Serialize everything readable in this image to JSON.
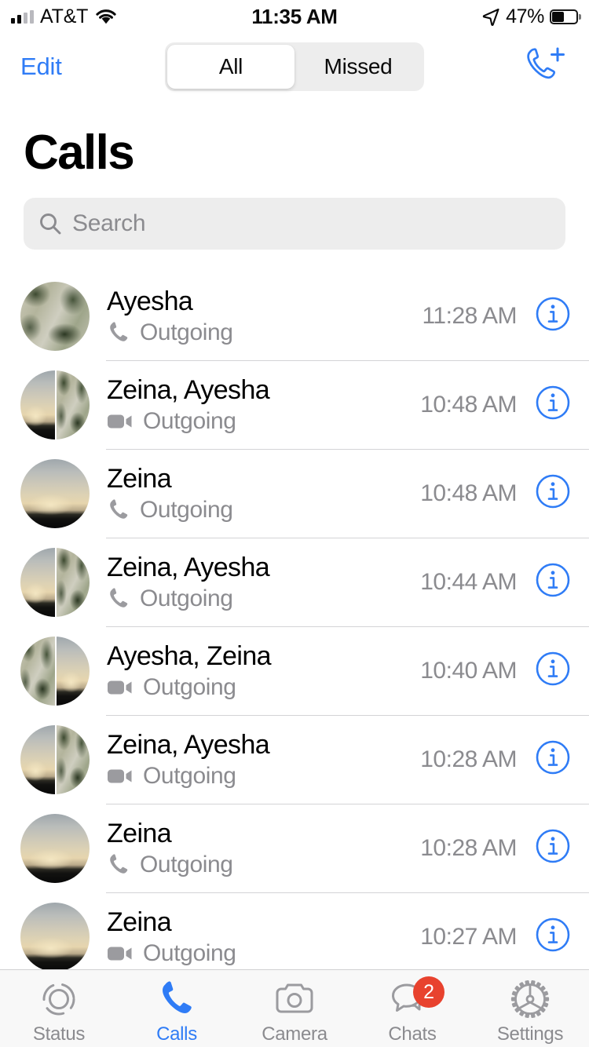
{
  "status_bar": {
    "carrier": "AT&T",
    "time": "11:35 AM",
    "battery_percent": "47%",
    "signal_bars_filled": 2,
    "signal_bars_total": 4,
    "wifi_icon": "wifi-icon",
    "location_icon": "location-arrow-icon"
  },
  "nav": {
    "edit_label": "Edit",
    "segments": [
      {
        "label": "All",
        "selected": true
      },
      {
        "label": "Missed",
        "selected": false
      }
    ],
    "new_call_icon": "phone-plus-icon"
  },
  "page_title": "Calls",
  "search": {
    "placeholder": "Search",
    "value": "",
    "icon": "search-icon"
  },
  "calls": [
    {
      "name": "Ayesha",
      "type": "Outgoing",
      "kind": "voice",
      "time": "11:28 AM",
      "avatars": [
        "leaf"
      ]
    },
    {
      "name": "Zeina, Ayesha",
      "type": "Outgoing",
      "kind": "video",
      "time": "10:48 AM",
      "avatars": [
        "sunset",
        "leaf"
      ]
    },
    {
      "name": "Zeina",
      "type": "Outgoing",
      "kind": "voice",
      "time": "10:48 AM",
      "avatars": [
        "sunset"
      ]
    },
    {
      "name": "Zeina, Ayesha",
      "type": "Outgoing",
      "kind": "voice",
      "time": "10:44 AM",
      "avatars": [
        "sunset",
        "leaf"
      ]
    },
    {
      "name": "Ayesha, Zeina",
      "type": "Outgoing",
      "kind": "video",
      "time": "10:40 AM",
      "avatars": [
        "leaf",
        "sunset"
      ]
    },
    {
      "name": "Zeina, Ayesha",
      "type": "Outgoing",
      "kind": "video",
      "time": "10:28 AM",
      "avatars": [
        "sunset",
        "leaf"
      ]
    },
    {
      "name": "Zeina",
      "type": "Outgoing",
      "kind": "voice",
      "time": "10:28 AM",
      "avatars": [
        "sunset"
      ]
    },
    {
      "name": "Zeina",
      "type": "Outgoing",
      "kind": "video",
      "time": "10:27 AM",
      "avatars": [
        "sunset"
      ]
    }
  ],
  "info_button_icon": "info-circle-icon",
  "tabs": [
    {
      "label": "Status",
      "icon": "status-rings-icon",
      "active": false,
      "badge": null
    },
    {
      "label": "Calls",
      "icon": "phone-icon",
      "active": true,
      "badge": null
    },
    {
      "label": "Camera",
      "icon": "camera-icon",
      "active": false,
      "badge": null
    },
    {
      "label": "Chats",
      "icon": "chat-bubbles-icon",
      "active": false,
      "badge": "2"
    },
    {
      "label": "Settings",
      "icon": "gear-icon",
      "active": false,
      "badge": null
    }
  ],
  "colors": {
    "accent_blue": "#2F7CF6",
    "badge_red": "#E8422E",
    "secondary_text": "#8B8B8F",
    "separator": "#D3D3D6",
    "field_bg": "#EDEDED",
    "tabbar_bg": "#F8F8F8"
  }
}
